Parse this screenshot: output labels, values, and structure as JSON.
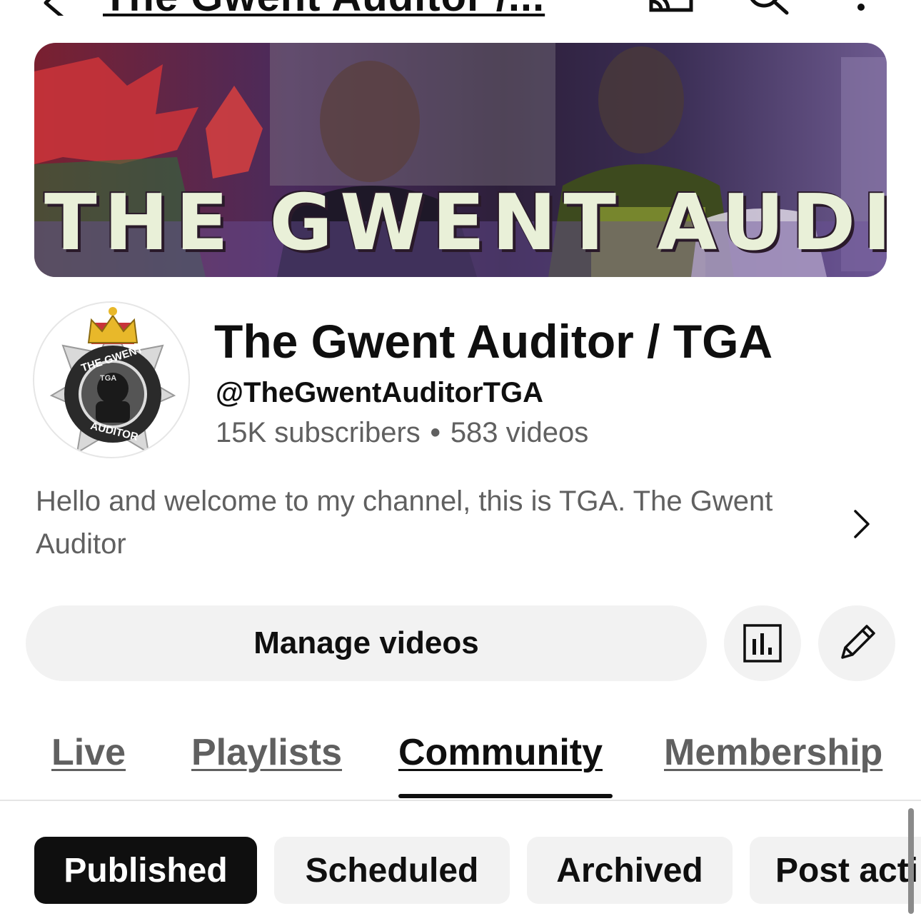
{
  "topbar": {
    "title": "The Gwent Auditor /..."
  },
  "banner": {
    "text": "THE GWENT AUDITO"
  },
  "avatar": {
    "ring_top": "THE GWENT",
    "ring_bottom": "AUDITOR",
    "inner": "TGA"
  },
  "channel": {
    "name": "The Gwent Auditor / TGA",
    "handle": "@TheGwentAuditorTGA",
    "subscribers": "15K subscribers",
    "separator": "•",
    "videos": "583 videos"
  },
  "description": "Hello and welcome to my channel, this is TGA. The Gwent Auditor",
  "actions": {
    "manage_label": "Manage videos"
  },
  "tabs": [
    {
      "label": "Live"
    },
    {
      "label": "Playlists"
    },
    {
      "label": "Community"
    },
    {
      "label": "Membership"
    }
  ],
  "chips": [
    {
      "label": "Published"
    },
    {
      "label": "Scheduled"
    },
    {
      "label": "Archived"
    },
    {
      "label": "Post acti"
    }
  ]
}
